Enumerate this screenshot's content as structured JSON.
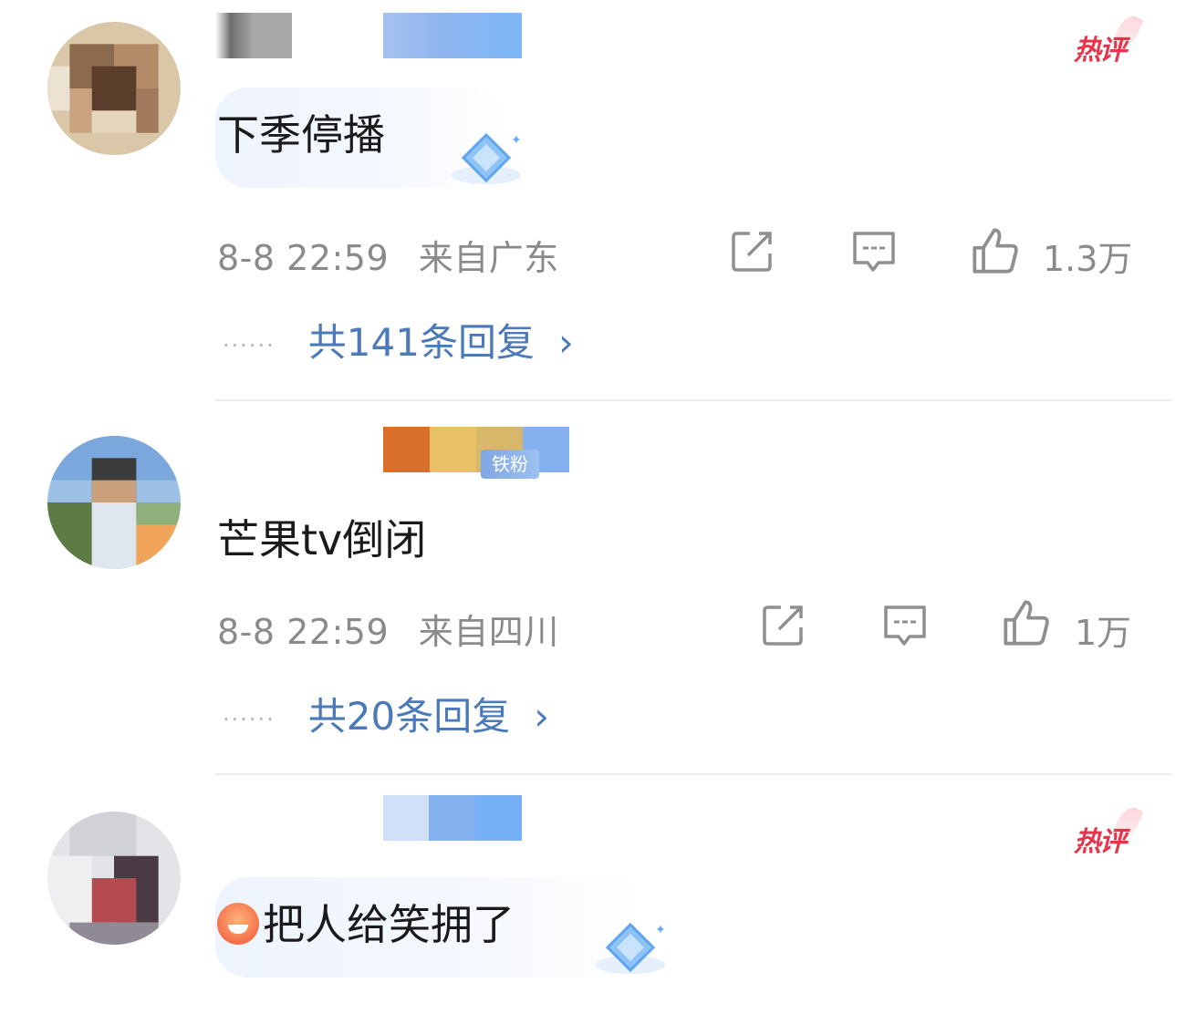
{
  "colors": {
    "link": "#4c79b8",
    "meta": "#8a8a8a",
    "hot": "#e8344a",
    "divider": "#ececec"
  },
  "comments": [
    {
      "hot_badge": "热评",
      "text": "下季停播",
      "time": "8-8 22:59",
      "location": "来自广东",
      "likes": "1.3万",
      "replies_dots": "······",
      "replies": "共141条回复",
      "chevron": "›"
    },
    {
      "fan_badge": "铁粉",
      "text": "芒果tv倒闭",
      "time": "8-8 22:59",
      "location": "来自四川",
      "likes": "1万",
      "replies_dots": "······",
      "replies": "共20条回复",
      "chevron": "›"
    },
    {
      "hot_badge": "热评",
      "text": "把人给笑拥了"
    }
  ],
  "icons": {
    "share": "share-icon",
    "comment": "comment-icon",
    "like": "thumbs-up-icon",
    "emoji": "laughing-emoji-icon"
  }
}
